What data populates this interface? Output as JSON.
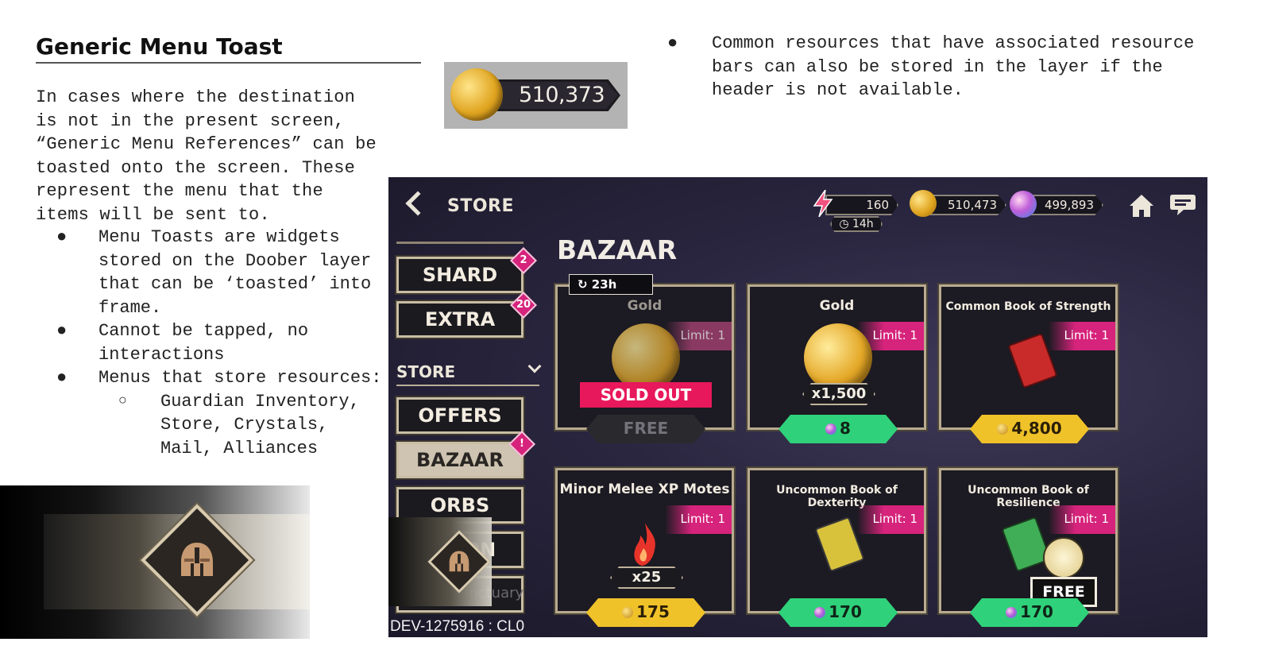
{
  "doc": {
    "title": "Generic Menu Toast",
    "intro": "In cases where the destination is not in the present screen, “Generic Menu References” can be toasted onto the screen.  These represent the menu that the items will be sent to.",
    "bullets": [
      "Menu Toasts are widgets stored on the Doober layer that can be ‘toasted’ into frame.",
      "Cannot be tapped, no interactions",
      "Menus that store resources:"
    ],
    "sub_bullets": [
      "Guardian Inventory, Store, Crystals, Mail, Alliances"
    ],
    "right_bullet": "Common resources that have associated resource bars can also be stored in the layer if the header is not available.",
    "bullet_glyph": "●",
    "sub_bullet_glyph": "○"
  },
  "chip": {
    "value": "510,373"
  },
  "game": {
    "header_title": "STORE",
    "resources": {
      "energy": "160",
      "energy_timer": "14h",
      "gold": "510,473",
      "gems": "499,893"
    },
    "sidebar": {
      "buttons": [
        {
          "label": "SHARD",
          "badge": "2"
        },
        {
          "label": "EXTRA",
          "badge": "20"
        }
      ],
      "section_label": "STORE",
      "store_buttons": [
        {
          "label": "OFFERS",
          "badge": ""
        },
        {
          "label": "BAZAAR",
          "badge": "!"
        },
        {
          "label": "ORBS",
          "badge": ""
        },
        {
          "label": "ON",
          "badge": ""
        }
      ],
      "sanctuary": "Ariel's Sanctuary"
    },
    "dev_label": "DEV-1275916 : CL0",
    "bazaar_title": "BAZAAR",
    "cards": [
      {
        "name": "Gold",
        "limit": "Limit: 1",
        "timer": "23h",
        "status": "SOLD OUT",
        "price": "FREE",
        "price_type": "free"
      },
      {
        "name": "Gold",
        "limit": "Limit: 1",
        "qty": "x1,500",
        "price": "8",
        "price_type": "gem"
      },
      {
        "name": "Common Book of Strength",
        "limit": "Limit: 1",
        "price": "4,800",
        "price_type": "gold"
      },
      {
        "name": "Minor Melee XP Motes",
        "limit": "Limit: 1",
        "qty": "x25",
        "price": "175",
        "price_type": "gold"
      },
      {
        "name": "Uncommon Book of Dexterity",
        "limit": "Limit: 1",
        "price": "170",
        "price_type": "gem"
      },
      {
        "name": "Uncommon Book of Resilience",
        "limit": "Limit: 1",
        "price": "170",
        "price_type": "gem",
        "tag": "FREE"
      }
    ]
  },
  "colors": {
    "badge": "#d6237b",
    "green_price": "#2fd27a",
    "gold_price": "#f0c22a",
    "sold_out": "#e8185c"
  }
}
